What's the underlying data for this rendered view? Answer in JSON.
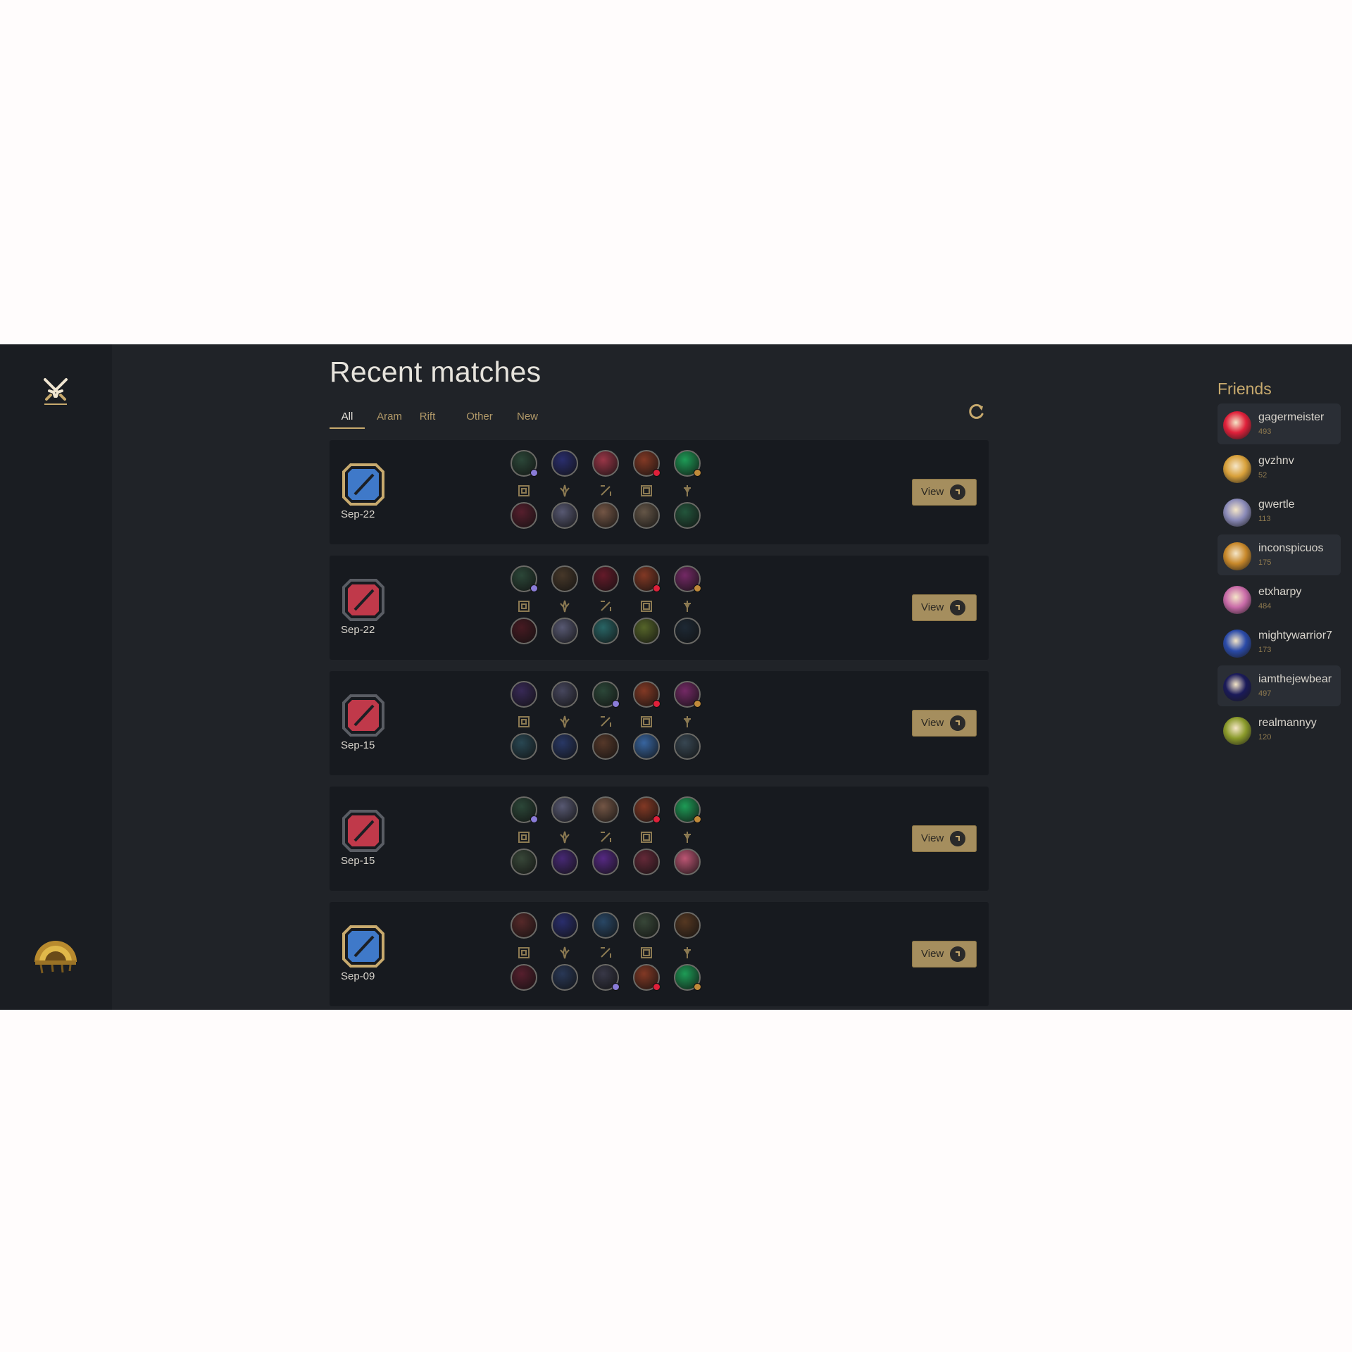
{
  "page": {
    "title": "Recent matches",
    "tabs": [
      "All",
      "Aram",
      "Rift",
      "Other",
      "New"
    ],
    "active_tab": "All"
  },
  "colors": {
    "gold": "#c8aa6e",
    "win_blue": "#3f79c9",
    "loss_red": "#c0394a",
    "panel_bg": "#171a1f",
    "app_bg": "#202328"
  },
  "matches": [
    {
      "result": "win",
      "date": "Sep-22",
      "view_label": "View",
      "top": [
        {
          "c": "#2d4a3a",
          "m": "#8a7cd8"
        },
        {
          "c": "#2b2f72",
          "m": null
        },
        {
          "c": "#a3384a",
          "m": null
        },
        {
          "c": "#8a3b25",
          "m": "#e0203a"
        },
        {
          "c": "#1ea55a",
          "m": "#c08a3a"
        }
      ],
      "bottom": [
        {
          "c": "#5a1f2e"
        },
        {
          "c": "#5c5d78"
        },
        {
          "c": "#7a5a48"
        },
        {
          "c": "#6a5a4a"
        },
        {
          "c": "#245a3e"
        }
      ]
    },
    {
      "result": "loss",
      "date": "Sep-22",
      "view_label": "View",
      "top": [
        {
          "c": "#2d4a3a",
          "m": "#8a7cd8"
        },
        {
          "c": "#4a3a2a",
          "m": null
        },
        {
          "c": "#6a1a2a",
          "m": null
        },
        {
          "c": "#8a3b25",
          "m": "#e0203a"
        },
        {
          "c": "#7a2a6a",
          "m": "#c08a3a"
        }
      ],
      "bottom": [
        {
          "c": "#4a1a22"
        },
        {
          "c": "#5c5d78"
        },
        {
          "c": "#2a6a6a"
        },
        {
          "c": "#5a6a2a"
        },
        {
          "c": "#1e2a36"
        }
      ]
    },
    {
      "result": "loss",
      "date": "Sep-15",
      "view_label": "View",
      "top": [
        {
          "c": "#3a2a5a",
          "m": null
        },
        {
          "c": "#4a4a62",
          "m": null
        },
        {
          "c": "#2d4a3a",
          "m": "#8a7cd8"
        },
        {
          "c": "#8a3b25",
          "m": "#e0203a"
        },
        {
          "c": "#7a2a6a",
          "m": "#c08a3a"
        }
      ],
      "bottom": [
        {
          "c": "#2a4a56"
        },
        {
          "c": "#2a3a6a"
        },
        {
          "c": "#5a3a2a"
        },
        {
          "c": "#3a6aa8"
        },
        {
          "c": "#3a4a56"
        }
      ]
    },
    {
      "result": "loss",
      "date": "Sep-15",
      "view_label": "View",
      "top": [
        {
          "c": "#2d4a3a",
          "m": "#8a7cd8"
        },
        {
          "c": "#5c5d78",
          "m": null
        },
        {
          "c": "#7a5a48",
          "m": null
        },
        {
          "c": "#8a3b25",
          "m": "#e0203a"
        },
        {
          "c": "#1ea55a",
          "m": "#c08a3a"
        }
      ],
      "bottom": [
        {
          "c": "#3a4a3a"
        },
        {
          "c": "#4a2a7a"
        },
        {
          "c": "#5a2a8a"
        },
        {
          "c": "#6a2a3a"
        },
        {
          "c": "#c85a7a"
        }
      ]
    },
    {
      "result": "win",
      "date": "Sep-09",
      "view_label": "View",
      "top": [
        {
          "c": "#5a2a2a",
          "m": null
        },
        {
          "c": "#2b2f72",
          "m": null
        },
        {
          "c": "#2a4a6a",
          "m": null
        },
        {
          "c": "#3a4a3a",
          "m": null
        },
        {
          "c": "#5a3a22",
          "m": null
        }
      ],
      "bottom": [
        {
          "c": "#5a1f2e"
        },
        {
          "c": "#2a3a5a"
        },
        {
          "c": "#3a3a4a",
          "m": "#8a7cd8"
        },
        {
          "c": "#8a3b25",
          "m": "#e0203a"
        },
        {
          "c": "#1ea55a",
          "m": "#c08a3a"
        }
      ]
    }
  ],
  "friends": {
    "title": "Friends",
    "items": [
      {
        "name": "gagermeister",
        "count": "493",
        "avatar": "#e0203a",
        "highlight": true
      },
      {
        "name": "gvzhnv",
        "count": "52",
        "avatar": "#d8a03a",
        "highlight": false
      },
      {
        "name": "gwertle",
        "count": "113",
        "avatar": "#8a8ab8",
        "highlight": false
      },
      {
        "name": "inconspicuos",
        "count": "175",
        "avatar": "#c8882a",
        "highlight": true
      },
      {
        "name": "etxharpy",
        "count": "484",
        "avatar": "#c86aa8",
        "highlight": false
      },
      {
        "name": "mightywarrior7",
        "count": "173",
        "avatar": "#2a4aa8",
        "highlight": false
      },
      {
        "name": "iamthejewbear",
        "count": "497",
        "avatar": "#1a1a5a",
        "highlight": true
      },
      {
        "name": "realmannyy",
        "count": "120",
        "avatar": "#8a9a2a",
        "highlight": false
      }
    ]
  }
}
